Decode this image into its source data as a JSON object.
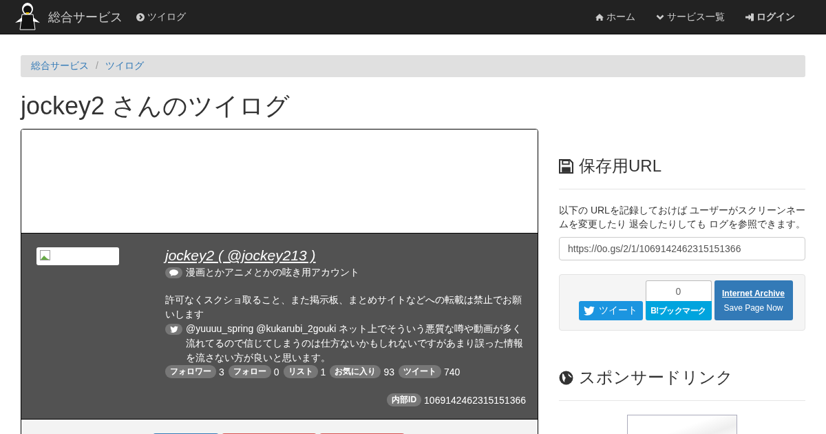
{
  "navbar": {
    "brand": "総合サービス",
    "link": "ツイログ",
    "menu": [
      {
        "label": "ホーム"
      },
      {
        "label": "サービス一覧"
      },
      {
        "label": "ログイン"
      }
    ]
  },
  "breadcrumb": [
    "総合サービス",
    "ツイログ"
  ],
  "breadcrumb_separator": "/",
  "page_title": "jockey2 さんのツイログ",
  "profile": {
    "name_link": "jockey2 ( @jockey213 )",
    "description": "漫画とかアニメとかの呟き用アカウント",
    "bio": "許可なくスクショ取ること、また掲示板、まとめサイトなどへの転載は禁止でお願いします",
    "latest_tweet": "@yuuuu_spring @kukarubi_2gouki ネット上でそういう悪質な噂や動画が多く流れてるので信じてしまうのは仕方ないかもしれないですがあまり誤った情報を流さない方が良いと思います。",
    "stats": [
      {
        "label": "フォロワー",
        "value": "3"
      },
      {
        "label": "フォロー",
        "value": "0"
      },
      {
        "label": "リスト",
        "value": "1"
      },
      {
        "label": "お気に入り",
        "value": "93"
      },
      {
        "label": "ツイート",
        "value": "740"
      }
    ],
    "internal_id": {
      "label": "内部ID",
      "value": "1069142462315151366"
    }
  },
  "save_url": {
    "heading": "保存用URL",
    "text": "以下の URLを記録しておけば ユーザーがスクリーンネームを変更したり 退会したりしても ログを参照できます。",
    "value": "https://0o.gs/2/1/1069142462315151366"
  },
  "share": {
    "tweet": "ツイート",
    "bookmark_count": "0",
    "bookmark": "B!ブックマーク",
    "archive_title": "Internet Archive",
    "archive_action": "Save Page Now"
  },
  "sponsored": {
    "heading": "スポンサードリンク"
  }
}
